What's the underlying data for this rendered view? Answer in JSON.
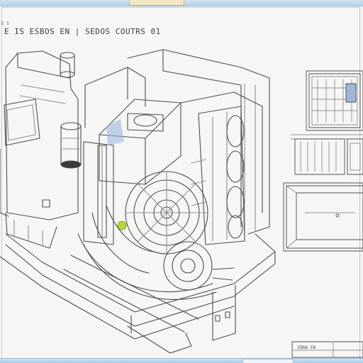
{
  "window": {
    "title_tab": "",
    "footer_tab": ""
  },
  "sheet": {
    "heading": "E IS ESBOS EN  |  SEDOS COUTRS 01",
    "stamp": "E  S",
    "title_block_label": "EBNA EB"
  },
  "colors": {
    "line": "#4a4d50",
    "line_light": "#8c9094",
    "accent_green": "#b6d63a",
    "accent_blue": "#9fb6d8",
    "paper": "#f6f7f5"
  },
  "icons": [
    "document-icon"
  ]
}
